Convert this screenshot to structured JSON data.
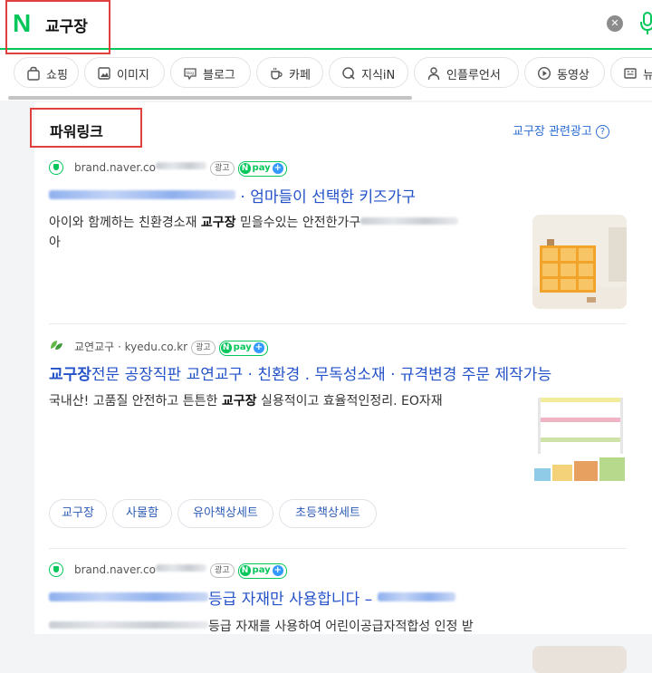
{
  "search": {
    "logo": "N",
    "query": "교구장"
  },
  "tabs": [
    {
      "label": "쇼핑",
      "icon": "shopping-bag-icon"
    },
    {
      "label": "이미지",
      "icon": "image-icon"
    },
    {
      "label": "블로그",
      "icon": "blog-icon"
    },
    {
      "label": "카페",
      "icon": "coffee-cup-icon"
    },
    {
      "label": "지식iN",
      "icon": "kin-q-icon"
    },
    {
      "label": "인플루언서",
      "icon": "person-icon"
    },
    {
      "label": "동영상",
      "icon": "play-icon"
    },
    {
      "label": "뉴",
      "icon": "news-icon"
    }
  ],
  "powerlink": {
    "title": "파워링크",
    "related_link": "교구장 관련광고",
    "ad_badge": "광고",
    "npay_label": "pay"
  },
  "ads": [
    {
      "source": "brand.naver.co",
      "headline_suffix": "· 엄마들이 선택한 키즈가구",
      "desc_before": "아이와 함께하는 친환경소재 ",
      "desc_bold": "교구장",
      "desc_after": " 믿을수있는 안전한가구",
      "desc_line2": "아"
    },
    {
      "source_name": "교연교구",
      "source_sep": " · ",
      "source_domain": "kyedu.co.kr",
      "headline_bold": "교구장",
      "headline_rest": "전문 공장직판 교연교구 · 친환경 . 무독성소재  · 규격변경 주문 제작가능",
      "desc_before": "국내산! 고품질 안전하고 튼튼한 ",
      "desc_bold": "교구장",
      "desc_after": " 실용적이고 효율적인정리. EO자재",
      "chips": [
        "교구장",
        "사물함",
        "유아책상세트",
        "초등책상세트"
      ]
    },
    {
      "source": "brand.naver.co",
      "headline_mid": "등급 자재만 사용합니다 –",
      "desc_mid": "등급 자재를 사용하여 어린이공급자적합성 인정 받"
    }
  ],
  "colors": {
    "naver_green": "#03c75a",
    "link_blue": "#2452c9",
    "highlight_red": "#e0413d"
  }
}
